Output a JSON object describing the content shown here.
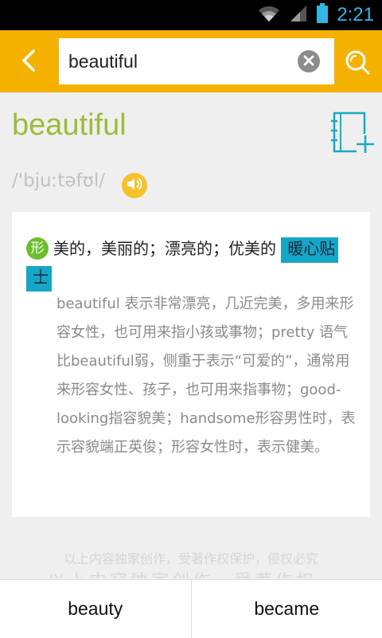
{
  "status_bar": {
    "time": "2:21",
    "icons": [
      "wifi-icon",
      "signal-icon",
      "battery-icon"
    ]
  },
  "toolbar": {
    "back_icon": "chevron-left-icon",
    "search_value": "beautiful",
    "clear_icon": "close-circle-icon",
    "search_icon": "search-icon"
  },
  "entry": {
    "word": "beautiful",
    "phonetic": "/'bjuːtəfʊl/",
    "wordbook_icon": "add-to-notebook-icon",
    "speaker_icon": "speaker-icon"
  },
  "definition": {
    "pos": "形",
    "meaning": "美的，美丽的；漂亮的；优美的",
    "tip_label": "暖心贴士",
    "note": "beautiful 表示非常漂亮，几近完美，多用来形容女性，也可用来指小孩或事物；pretty 语气比beautiful弱，侧重于表示“可爱的”，通常用来形容女性、孩子，也可用来指事物；good-looking指容貌美；handsome形容男性时，表示容貌端正英俊；形容女性时，表示健美。"
  },
  "footer": {
    "copyright": "以上内容独家创作，受著作权保护，侵权必究"
  },
  "bottom_nav": {
    "prev_word": "beauty",
    "next_word": "became"
  },
  "colors": {
    "toolbar_bg": "#f5b100",
    "headword": "#9cbc3a",
    "pos_badge": "#6abf2d",
    "tip_tag": "#16a6c7",
    "status_accent": "#33b5e5"
  }
}
